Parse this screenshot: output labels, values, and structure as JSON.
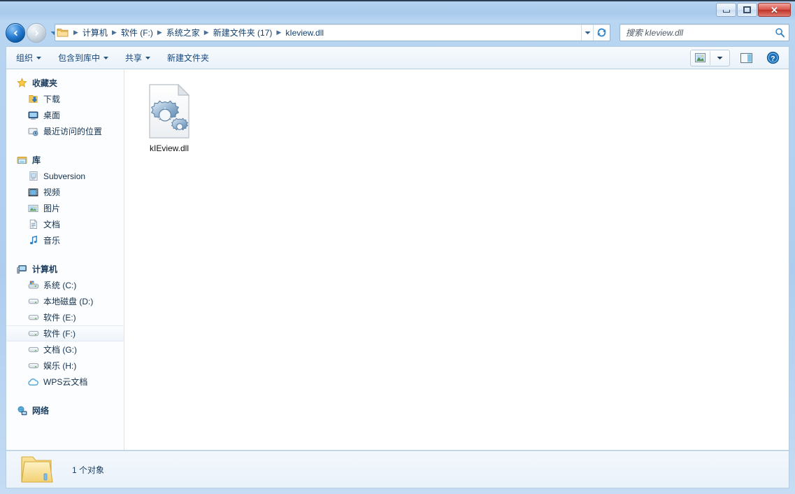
{
  "window": {
    "controls": {
      "minimize_label": "最小化",
      "maximize_label": "最大化",
      "close_label": "关闭"
    }
  },
  "nav": {
    "back_label": "后退",
    "forward_label": "前进",
    "history_label": "最近浏览的位置",
    "breadcrumbs": [
      "计算机",
      "软件 (F:)",
      "系统之家",
      "新建文件夹 (17)",
      "kIeview.dll"
    ],
    "dropdown_label": "▼",
    "refresh_label": "刷新"
  },
  "search": {
    "placeholder": "搜索 kIeview.dll"
  },
  "toolbar": {
    "items": [
      {
        "label": "组织",
        "has_caret": true
      },
      {
        "label": "包含到库中",
        "has_caret": true
      },
      {
        "label": "共享",
        "has_caret": true
      },
      {
        "label": "新建文件夹",
        "has_caret": false
      }
    ],
    "view_label": "更改您的视图",
    "view_caret_label": "视图选项",
    "preview_label": "显示预览窗格",
    "help_label": "帮助"
  },
  "sidebar": {
    "groups": [
      {
        "header": "收藏夹",
        "header_icon": "star-icon",
        "items": [
          {
            "label": "下载",
            "icon": "download-icon"
          },
          {
            "label": "桌面",
            "icon": "desktop-icon"
          },
          {
            "label": "最近访问的位置",
            "icon": "recent-places-icon"
          }
        ]
      },
      {
        "header": "库",
        "header_icon": "library-icon",
        "items": [
          {
            "label": "Subversion",
            "icon": "subversion-icon"
          },
          {
            "label": "视频",
            "icon": "video-icon"
          },
          {
            "label": "图片",
            "icon": "pictures-icon"
          },
          {
            "label": "文档",
            "icon": "documents-icon"
          },
          {
            "label": "音乐",
            "icon": "music-icon"
          }
        ]
      },
      {
        "header": "计算机",
        "header_icon": "computer-icon",
        "items": [
          {
            "label": "系统 (C:)",
            "icon": "system-drive-icon"
          },
          {
            "label": "本地磁盘 (D:)",
            "icon": "drive-icon"
          },
          {
            "label": "软件 (E:)",
            "icon": "drive-icon"
          },
          {
            "label": "软件 (F:)",
            "icon": "drive-icon",
            "selected": true
          },
          {
            "label": "文档 (G:)",
            "icon": "drive-icon"
          },
          {
            "label": "娱乐 (H:)",
            "icon": "drive-icon"
          },
          {
            "label": "WPS云文档",
            "icon": "cloud-icon"
          }
        ]
      },
      {
        "header": "网络",
        "header_icon": "network-icon",
        "items": []
      }
    ]
  },
  "content": {
    "files": [
      {
        "name": "kIEview.dll",
        "icon": "dll-gears-icon"
      }
    ]
  },
  "status": {
    "text": "1 个对象",
    "icon": "folder-icon"
  },
  "colors": {
    "titlebar": "#aecdee",
    "accent": "#15457a",
    "close_button": "#bf3328",
    "selection": "#eef4fa"
  }
}
